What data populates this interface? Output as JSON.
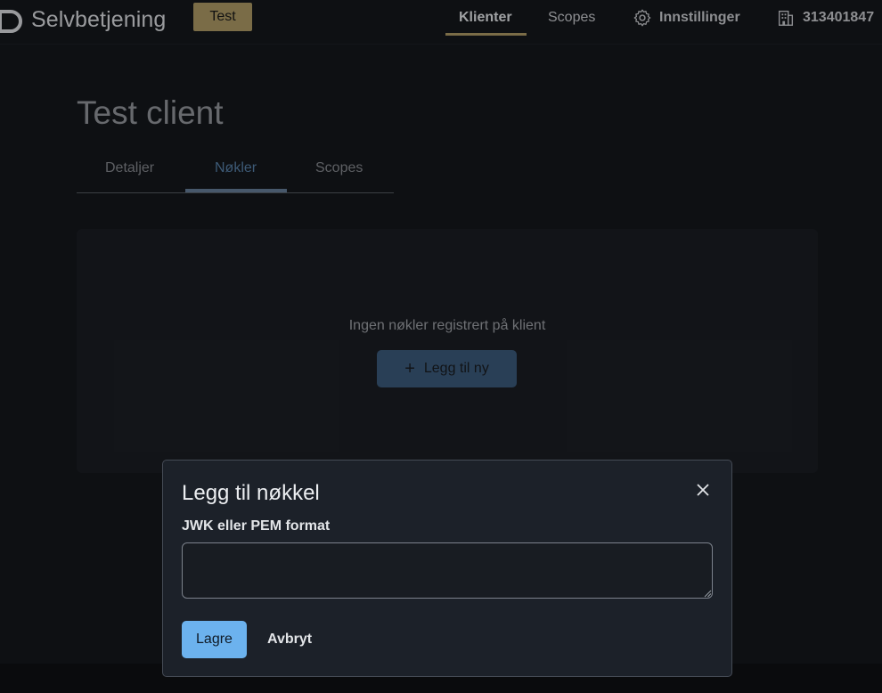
{
  "header": {
    "brand_name": "Selvbetjening",
    "environment_badge": "Test",
    "nav": {
      "clients": "Klienter",
      "scopes": "Scopes",
      "settings": "Innstillinger",
      "organization": "313401847"
    },
    "active_nav": "Klienter"
  },
  "page": {
    "title": "Test client",
    "tabs": [
      "Detaljer",
      "Nøkler",
      "Scopes"
    ],
    "active_tab": "Nøkler"
  },
  "keys_panel": {
    "empty_message": "Ingen nøkler registrert på klient",
    "add_button_label": "Legg til ny",
    "add_icon": "plus-icon"
  },
  "modal": {
    "title": "Legg til nøkkel",
    "field_label": "JWK eller PEM format",
    "field_value": "",
    "save_label": "Lagre",
    "cancel_label": "Avbryt",
    "close_icon": "close-icon"
  },
  "colors": {
    "background": "#15181d",
    "accent_gold": "#b6a26a",
    "tab_active": "#5b86b0",
    "primary_button": "#6cb2ee",
    "dim_button": "#3e5f80"
  }
}
